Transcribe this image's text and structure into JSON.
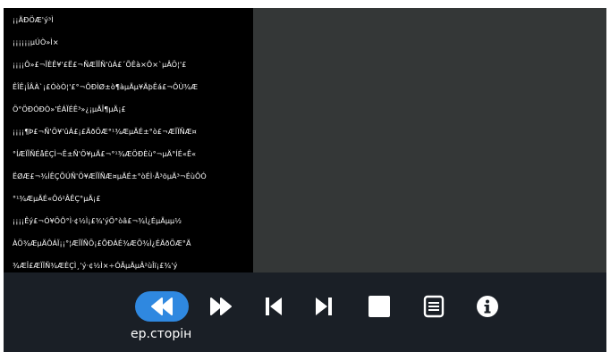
{
  "document": {
    "lines": [
      "¡¡ÄÐÖÆ'ý³Ì",
      "¡¡¡¡¡¡µÚÒ»Ì×",
      "¡¡¡¡Ô»£¬ÏÈÊ¥'£Ë£¬ÑÆÏÏÑ'ûÁ£´ÕÊà×Ô×`µÂÖ¦'£",
      "ÊÎÊ¡ÎÂÀ`¡£ÓòÒ¦'£°¬ÔÐÌØ±ò¶àµÄµ¥ÄþÊá£¬ÔÙ¾Æ",
      "Ö°ÖÐÓÐÒ»'ÉÁÏÉÊ³»¿¡µÄÎ¶µÄ¡£",
      "¡¡¡¡¶Þ£¬Ñ'Ö¥'ûÁ£¡£ÄðÖÆ°¹¾ÆµÄÉ±°ò£¬ÆÏÏÑÆ¤",
      "°ÍÆÏÏÑÉåÈÇÌ¬Ê±Ñ'Ö¥µÄ£¬°¹¾ÆÖÐÈù°¬µÄ°ÍÉ«Ê«",
      "ËØÆ£¬¾ÍÊÇÕÚÑ'Ö¥ÆÏÏÑÆ¤µÄÉ±°òÉÌ·Å³öµÄ³¬ÉùÔÓ",
      "°¹¾ÆµÄÉ«Ôó²ÂÊÇ°µÄ¡£",
      "¡¡¡¡Êý£¬Ó¥ÖÔ°Ì·¢½Ì¡£¾'ýÖ°òâ£¬¾Ì¿ÉµÄµµ½",
      "ÀÖ¾ÆµÄÔÁÏ¡¡°¦ÆÏÏÑÖ¡£ÕÐÁÉ¾ÆÖ¾Ì¿ÉÄðÖÆ°Ä",
      "¾ÆÎ£ÆÏÏÑ¾ÆÈÇÌ¸'ý·¢½Ì×÷ÓÃµÄµÂ²ùÎï¡£¾'ý"
    ]
  },
  "toolbar": {
    "active_label": "ер.сторін",
    "buttons": [
      {
        "name": "rewind-button",
        "icon": "rewind-icon",
        "active": true
      },
      {
        "name": "fast-forward-button",
        "icon": "fast-forward-icon",
        "active": false
      },
      {
        "name": "skip-to-start-button",
        "icon": "skip-start-icon",
        "active": false
      },
      {
        "name": "skip-to-end-button",
        "icon": "skip-end-icon",
        "active": false
      },
      {
        "name": "stop-button",
        "icon": "stop-icon",
        "active": false
      },
      {
        "name": "list-button",
        "icon": "list-icon",
        "active": false
      },
      {
        "name": "info-button",
        "icon": "info-icon",
        "active": false
      }
    ]
  },
  "colors": {
    "background": "#343737",
    "toolbar": "#1a1f26",
    "active_button": "#2f88e0",
    "text": "#ffffff"
  }
}
